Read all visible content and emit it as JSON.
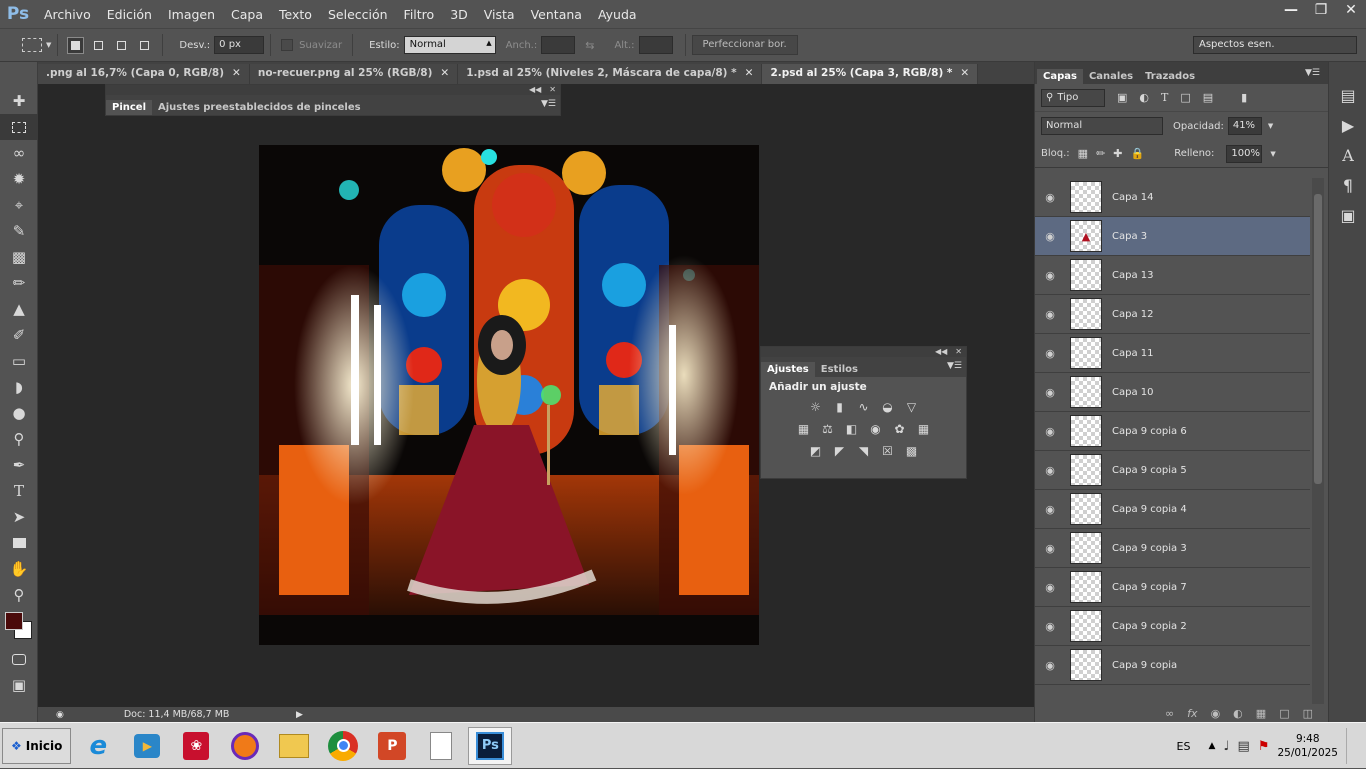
{
  "app": {
    "logo": "Ps"
  },
  "menu": [
    "Archivo",
    "Edición",
    "Imagen",
    "Capa",
    "Texto",
    "Selección",
    "Filtro",
    "3D",
    "Vista",
    "Ventana",
    "Ayuda"
  ],
  "window_controls": {
    "minimize": "minimize-icon",
    "restore": "restore-icon",
    "close": "close-icon"
  },
  "options": {
    "desv_label": "Desv.:",
    "desv_value": "0 px",
    "suavizar_label": "Suavizar",
    "estilo_label": "Estilo:",
    "estilo_value": "Normal",
    "anch_label": "Anch.:",
    "alt_label": "Alt.:",
    "refine_button": "Perfeccionar bor.",
    "workspace": "Aspectos esen."
  },
  "tabs": [
    {
      "label": ".png al 16,7% (Capa 0, RGB/8)",
      "active": false
    },
    {
      "label": "no-recuer.png al 25% (RGB/8)",
      "active": false
    },
    {
      "label": "1.psd al 25% (Niveles 2, Máscara de capa/8) *",
      "active": false
    },
    {
      "label": "2.psd al 25% (Capa 3, RGB/8) *",
      "active": true
    }
  ],
  "brush_panel": {
    "tabs": [
      "Pincel",
      "Ajustes preestablecidos de pinceles"
    ]
  },
  "adjust_panel": {
    "tabs": [
      "Ajustes",
      "Estilos"
    ],
    "heading": "Añadir un ajuste"
  },
  "status": {
    "doc": "Doc: 11,4 MB/68,7 MB"
  },
  "layers_panel": {
    "tabs": [
      "Capas",
      "Canales",
      "Trazados"
    ],
    "filter": "Tipo",
    "blend_mode": "Normal",
    "opacity_label": "Opacidad:",
    "opacity_value": "41%",
    "lock_label": "Bloq.:",
    "fill_label": "Relleno:",
    "fill_value": "100%",
    "layers": [
      {
        "name": "Capa 14",
        "selected": false
      },
      {
        "name": "Capa 3",
        "selected": true
      },
      {
        "name": "Capa 13",
        "selected": false
      },
      {
        "name": "Capa 12",
        "selected": false
      },
      {
        "name": "Capa 11",
        "selected": false
      },
      {
        "name": "Capa 10",
        "selected": false
      },
      {
        "name": "Capa 9 copia 6",
        "selected": false
      },
      {
        "name": "Capa 9 copia 5",
        "selected": false
      },
      {
        "name": "Capa 9 copia 4",
        "selected": false
      },
      {
        "name": "Capa 9 copia 3",
        "selected": false
      },
      {
        "name": "Capa 9 copia 7",
        "selected": false
      },
      {
        "name": "Capa 9 copia 2",
        "selected": false
      },
      {
        "name": "Capa 9 copia",
        "selected": false
      }
    ]
  },
  "taskbar": {
    "start": "Inicio",
    "lang": "ES",
    "time": "9:48",
    "date": "25/01/2025"
  },
  "colors": {
    "foreground": "#4a0a0a",
    "background": "#ffffff",
    "selection": "#5d6a82"
  }
}
